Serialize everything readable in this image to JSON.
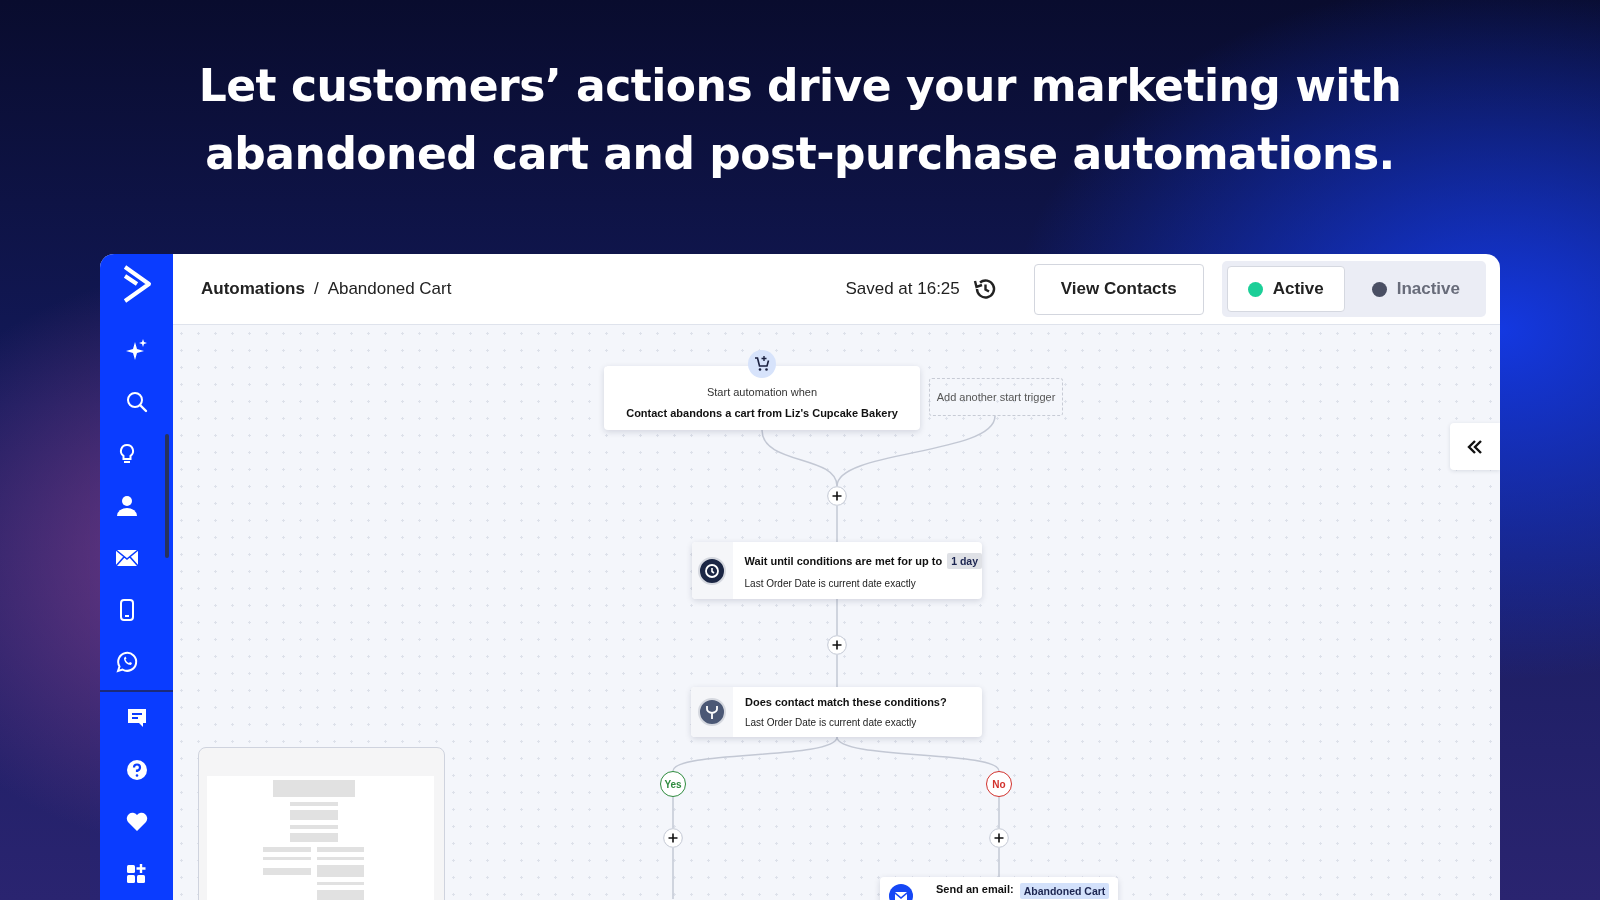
{
  "headline": [
    "Let customers’ actions drive your marketing with",
    "abandoned cart and post-purchase automations."
  ],
  "header": {
    "breadcrumb": [
      "Automations",
      "Abandoned Cart"
    ],
    "separator": "/",
    "saved": "Saved at 16:25",
    "view_button": "View Contacts",
    "status_toggle": [
      {
        "label": "Active",
        "color": "#1ccf98",
        "selected": true
      },
      {
        "label": "Inactive",
        "color": "#4a4f63",
        "selected": false
      }
    ]
  },
  "canvas": {
    "trigger": {
      "caption": "Start automation when",
      "title": "Contact abandons a cart from Liz's Cupcake Bakery"
    },
    "add_trigger": "Add another start trigger",
    "wait": {
      "title": "Wait until conditions are met for up to",
      "badge": "1 day",
      "detail": "Last Order Date is current date exactly"
    },
    "condition": {
      "title": "Does contact match these conditions?",
      "detail": "Last Order Date is current date exactly"
    },
    "branches": [
      {
        "label": "Yes",
        "kind": "yes"
      },
      {
        "label": "No",
        "kind": "no"
      }
    ],
    "email": {
      "title": "Send an email:",
      "badge": "Abandoned Cart"
    }
  }
}
